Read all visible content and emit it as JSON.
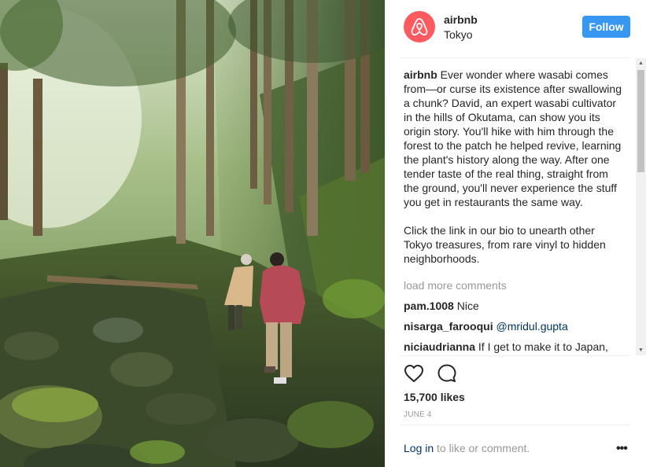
{
  "post": {
    "username": "airbnb",
    "location": "Tokyo",
    "follow_label": "Follow",
    "caption_user": "airbnb",
    "caption_text": " Ever wonder where wasabi comes from—or curse its existence after swallowing a chunk? David, an expert wasabi cultivator in the hills of Okutama, can show you its origin story. You'll hike with him through the forest to the patch he helped revive, learning the plant's history along the way. After one tender taste of the real thing, straight from the ground, you'll never experience the stuff you get in restaurants the same way.\n\nClick the link in our bio to unearth other Tokyo treasures, from rare vinyl to hidden neighborhoods.",
    "load_more": "load more comments",
    "comments": [
      {
        "user": "pam.1008",
        "text": "Nice"
      },
      {
        "user": "nisarga_farooqui",
        "text": "@mridul.gupta"
      },
      {
        "user": "niciaudrianna",
        "text": "If I get to make it to Japan,"
      }
    ],
    "likes": "15,700 likes",
    "date": "JUNE 4",
    "login_link": "Log in",
    "login_suffix": " to like or comment.",
    "more_label": "•••"
  },
  "icons": {
    "avatar": "airbnb-logo-icon",
    "like": "heart-icon",
    "comment": "comment-bubble-icon",
    "more": "more-options-icon"
  },
  "colors": {
    "brand": "#ff5a5f",
    "follow": "#3897f0",
    "link": "#003569",
    "muted": "#999999"
  }
}
